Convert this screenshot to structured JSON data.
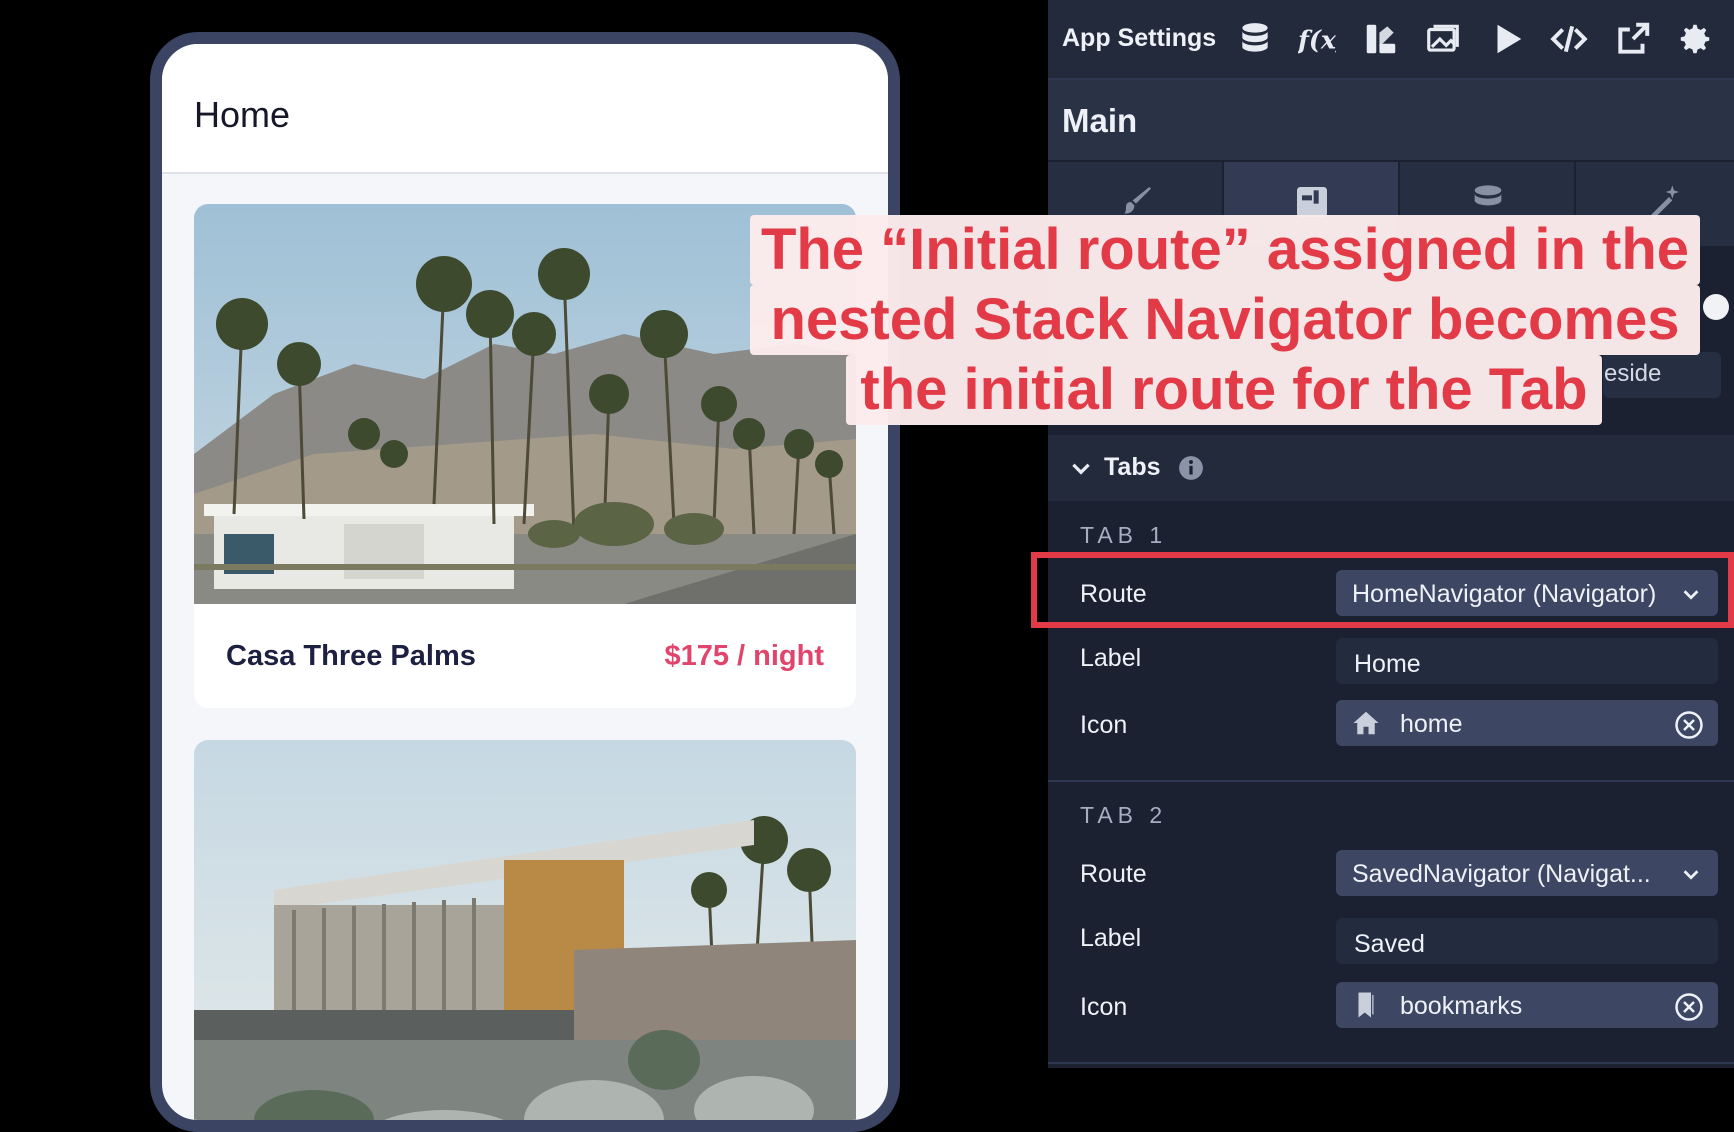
{
  "preview": {
    "screen_title": "Home",
    "cards": [
      {
        "name": "Casa Three Palms",
        "price": "$175 / night"
      }
    ]
  },
  "toolbar": {
    "title": "App Settings",
    "icons": [
      "database-icon",
      "function-icon",
      "theme-icon",
      "media-icon",
      "play-icon",
      "code-icon",
      "share-icon",
      "gear-icon"
    ]
  },
  "panel": {
    "screen_name": "Main",
    "partial_text": "eside",
    "section": {
      "label": "Tabs"
    },
    "tabs": [
      {
        "heading": "TAB 1",
        "route_label": "Route",
        "route_value": "HomeNavigator (Navigator)",
        "label_label": "Label",
        "label_value": "Home",
        "icon_label": "Icon",
        "icon_value": "home",
        "icon_glyph": "home-icon"
      },
      {
        "heading": "TAB 2",
        "route_label": "Route",
        "route_value": "SavedNavigator (Navigat...",
        "label_label": "Label",
        "label_value": "Saved",
        "icon_label": "Icon",
        "icon_value": "bookmarks",
        "icon_glyph": "bookmark-icon"
      }
    ]
  },
  "annotation": {
    "lines": [
      "The “Initial route” assigned in the",
      "nested Stack Navigator becomes",
      "the initial route for the Tab"
    ],
    "color": "#e23a47"
  }
}
